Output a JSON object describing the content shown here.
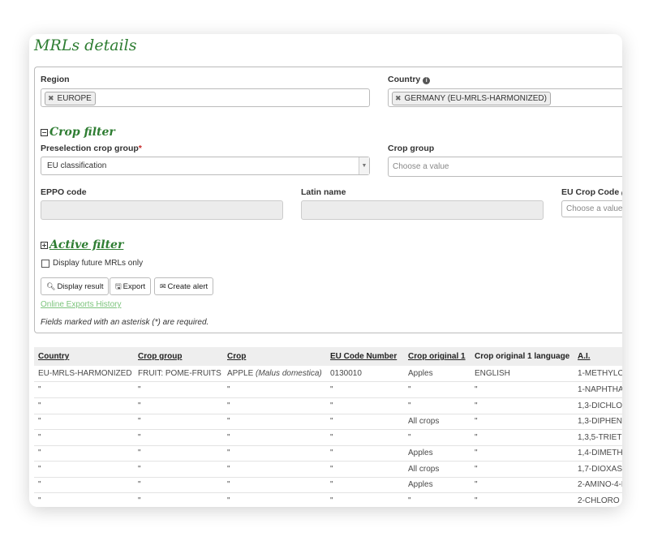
{
  "page": {
    "title": "MRLs details"
  },
  "form": {
    "region": {
      "label": "Region",
      "chip": "EUROPE"
    },
    "country": {
      "label": "Country",
      "chip": "GERMANY (EU-MRLS-HARMONIZED)"
    },
    "crop_filter": {
      "title": "Crop filter",
      "preselection": {
        "label": "Preselection crop group",
        "required_mark": "*",
        "value": "EU classification"
      },
      "crop_group": {
        "label": "Crop group",
        "placeholder": "Choose a value"
      },
      "eppo_code": {
        "label": "EPPO code"
      },
      "latin_name": {
        "label": "Latin name"
      },
      "eu_crop_code": {
        "label": "EU Crop Code",
        "placeholder": "Choose a value"
      }
    },
    "active_filter": {
      "title": "Active filter",
      "future_mrls_label": "Display future MRLs only",
      "future_mrls_checked": false
    },
    "buttons": {
      "display": "Display result",
      "export": "Export",
      "alert": "Create alert"
    },
    "exports_link": "Online Exports History",
    "required_note": "Fields marked with an asterisk (*) are required."
  },
  "table": {
    "headers": [
      "Country",
      "Crop group",
      "Crop",
      "EU Code Number",
      "Crop original 1",
      "Crop original 1 language",
      "A.I."
    ],
    "first_row": {
      "country": "EU-MRLS-HARMONIZED",
      "crop_group": "FRUIT: POME-FRUITS",
      "crop": "APPLE",
      "crop_latin": "(Malus domestica)",
      "eu_code": "0130010",
      "original": "Apples",
      "language": "ENGLISH",
      "ai": "1-METHYLC"
    },
    "rows": [
      {
        "c0": "\"",
        "c1": "\"",
        "c2": "\"",
        "c3": "\"",
        "c4": "\"",
        "c5": "\"",
        "c6": "1-NAPHTHA"
      },
      {
        "c0": "\"",
        "c1": "\"",
        "c2": "\"",
        "c3": "\"",
        "c4": "\"",
        "c5": "\"",
        "c6": "1,3-DICHLO"
      },
      {
        "c0": "\"",
        "c1": "\"",
        "c2": "\"",
        "c3": "\"",
        "c4": "All crops",
        "c5": "\"",
        "c6": "1,3-DIPHEN"
      },
      {
        "c0": "\"",
        "c1": "\"",
        "c2": "\"",
        "c3": "\"",
        "c4": "\"",
        "c5": "\"",
        "c6": "1,3,5-TRIET"
      },
      {
        "c0": "\"",
        "c1": "\"",
        "c2": "\"",
        "c3": "\"",
        "c4": "Apples",
        "c5": "\"",
        "c6": "1,4-DIMETH"
      },
      {
        "c0": "\"",
        "c1": "\"",
        "c2": "\"",
        "c3": "\"",
        "c4": "All crops",
        "c5": "\"",
        "c6": "1,7-DIOXAS"
      },
      {
        "c0": "\"",
        "c1": "\"",
        "c2": "\"",
        "c3": "\"",
        "c4": "Apples",
        "c5": "\"",
        "c6": "2-AMINO-4-N"
      },
      {
        "c0": "\"",
        "c1": "\"",
        "c2": "\"",
        "c3": "\"",
        "c4": "\"",
        "c5": "\"",
        "c6": "2-CHLORO"
      }
    ]
  },
  "colors": {
    "accent_green": "#2e7d32",
    "link_green": "#7cc47c",
    "required_red": "#c62828"
  },
  "icons": {
    "info": "info-icon",
    "collapse": "minus-square-icon",
    "expand": "plus-square-icon",
    "search": "search-icon",
    "export": "floppy-icon",
    "alert": "envelope-icon",
    "remove": "close-icon",
    "dropdown": "chevron-down-icon"
  }
}
